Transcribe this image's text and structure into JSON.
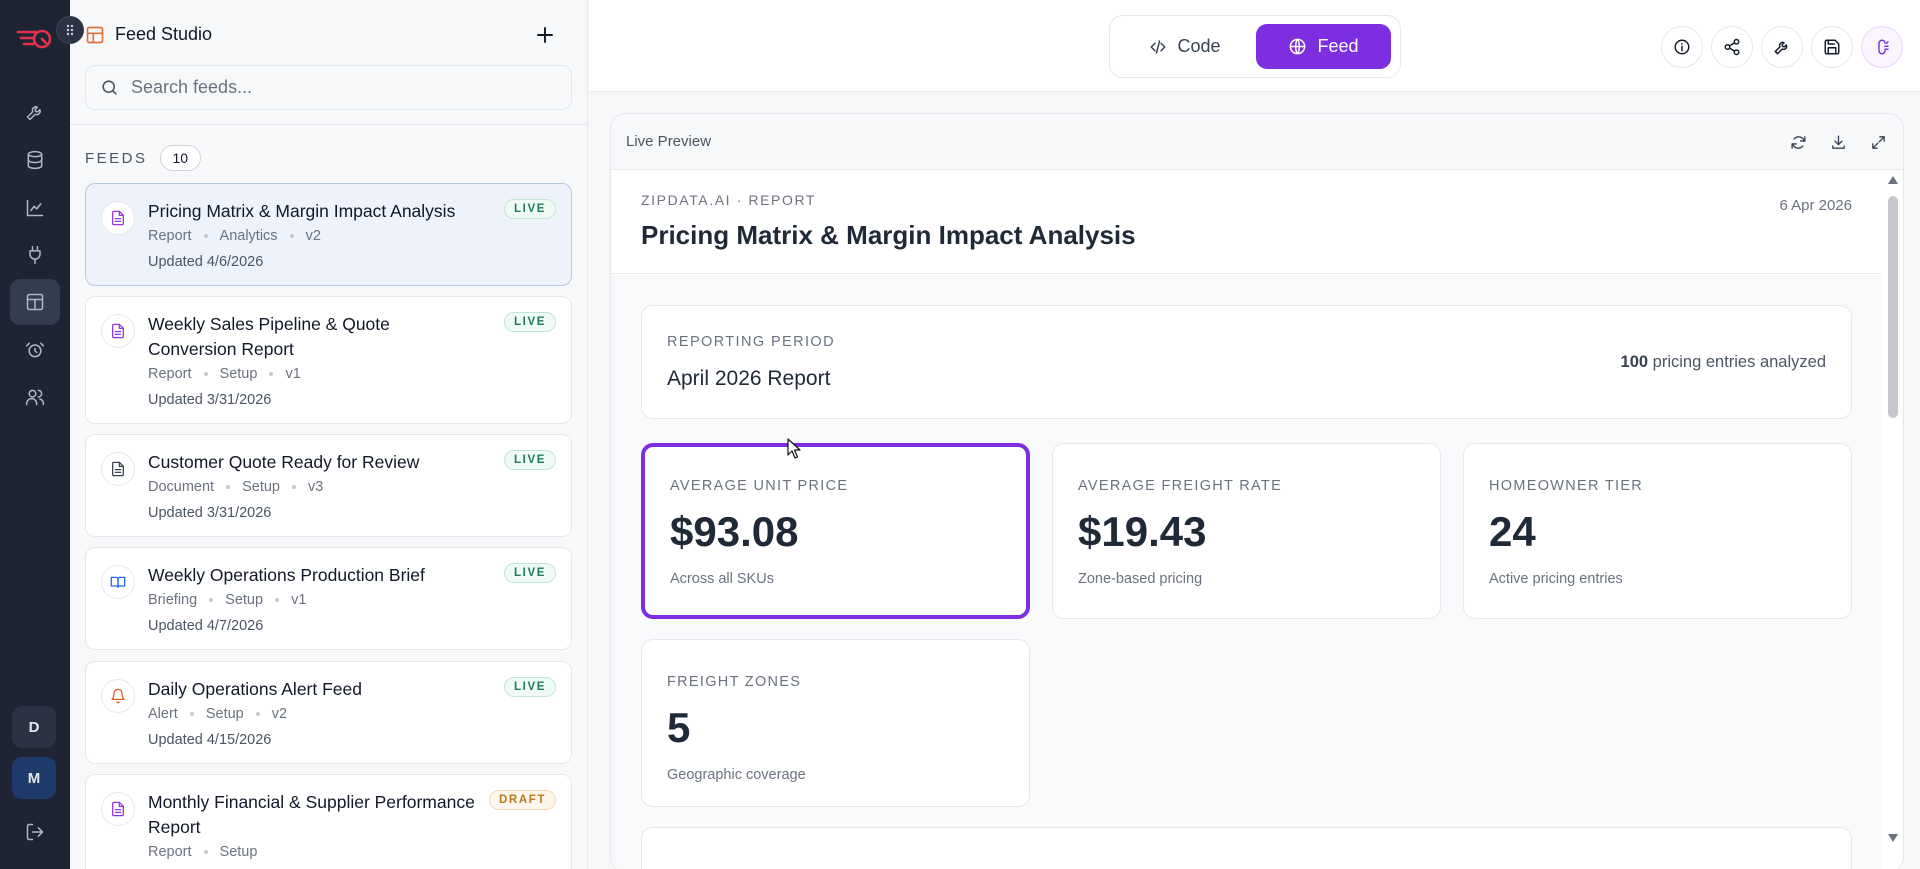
{
  "rail": {
    "items": [
      "tools",
      "database",
      "analytics",
      "integrations",
      "feed-studio",
      "alarms",
      "users"
    ],
    "active": "feed-studio",
    "avatars": [
      {
        "initial": "D",
        "bg": "#2b3243",
        "color": "#e5e7eb"
      },
      {
        "initial": "M",
        "bg": "#1e3a6b",
        "color": "#e5e7eb"
      }
    ],
    "brand_color": "#e0334b"
  },
  "sidebar": {
    "title": "Feed Studio",
    "search_placeholder": "Search feeds...",
    "feeds_label": "FEEDS",
    "feeds_count": "10",
    "cards": [
      {
        "title": "Pricing Matrix & Margin Impact Analysis",
        "meta": [
          "Report",
          "Analytics",
          "v2"
        ],
        "updated": "Updated 4/6/2026",
        "status": "LIVE",
        "icon": "document-icon",
        "icon_color": "#9333ea",
        "selected": true
      },
      {
        "title": "Weekly Sales Pipeline & Quote Conversion Report",
        "meta": [
          "Report",
          "Setup",
          "v1"
        ],
        "updated": "Updated 3/31/2026",
        "status": "LIVE",
        "icon": "document-icon",
        "icon_color": "#9333ea"
      },
      {
        "title": "Customer Quote Ready for Review",
        "meta": [
          "Document",
          "Setup",
          "v3"
        ],
        "updated": "Updated 3/31/2026",
        "status": "LIVE",
        "icon": "document-icon",
        "icon_color": "#374151"
      },
      {
        "title": "Weekly Operations Production Brief",
        "meta": [
          "Briefing",
          "Setup",
          "v1"
        ],
        "updated": "Updated 4/7/2026",
        "status": "LIVE",
        "icon": "book-icon",
        "icon_color": "#2563eb"
      },
      {
        "title": "Daily Operations Alert Feed",
        "meta": [
          "Alert",
          "Setup",
          "v2"
        ],
        "updated": "Updated 4/15/2026",
        "status": "LIVE",
        "icon": "bell-icon",
        "icon_color": "#e05a2b"
      },
      {
        "title": "Monthly Financial & Supplier Performance Report",
        "meta": [
          "Report",
          "Setup"
        ],
        "updated": "",
        "status": "DRAFT",
        "icon": "document-icon",
        "icon_color": "#9333ea"
      }
    ]
  },
  "topbar": {
    "code_label": "Code",
    "feed_label": "Feed",
    "accent": "#7c2ee0",
    "icons": [
      "info-icon",
      "share-icon",
      "wrench-icon",
      "save-icon",
      "ai-assistant-icon"
    ]
  },
  "preview": {
    "label": "Live Preview",
    "kicker": "ZIPDATA.AI · REPORT",
    "title": "Pricing Matrix & Margin Impact Analysis",
    "date": "6 Apr 2026",
    "period_label": "REPORTING PERIOD",
    "period_value": "April 2026 Report",
    "entries_count": "100",
    "entries_text": " pricing entries analyzed",
    "metrics": [
      {
        "label": "AVERAGE UNIT PRICE",
        "value": "$93.08",
        "sub": "Across all SKUs"
      },
      {
        "label": "AVERAGE FREIGHT RATE",
        "value": "$19.43",
        "sub": "Zone-based pricing"
      },
      {
        "label": "HOMEOWNER TIER",
        "value": "24",
        "sub": "Active pricing entries"
      },
      {
        "label": "FREIGHT ZONES",
        "value": "5",
        "sub": "Geographic coverage"
      }
    ]
  }
}
